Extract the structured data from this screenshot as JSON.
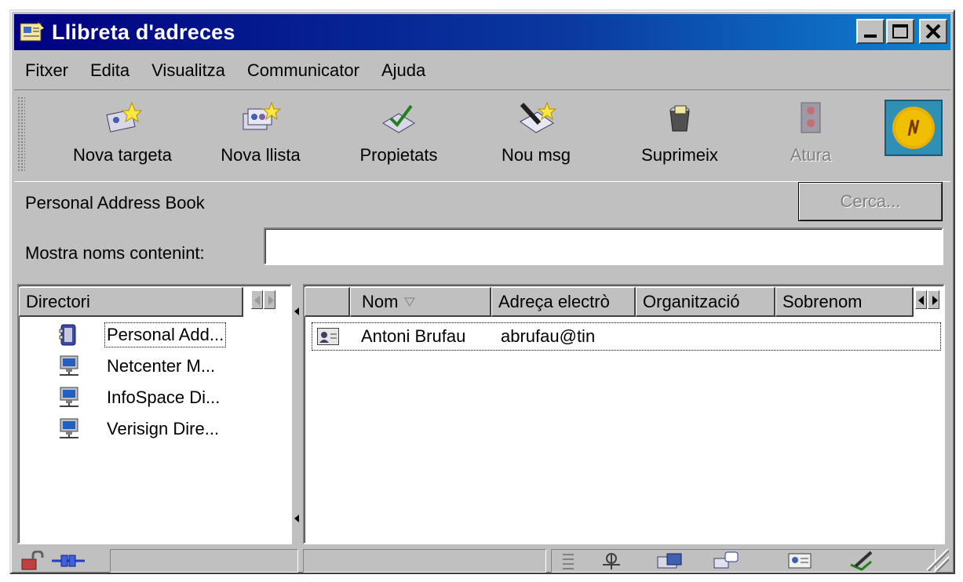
{
  "window": {
    "title": "Llibreta d'adreces"
  },
  "menu": [
    {
      "label": "Fitxer"
    },
    {
      "label": "Edita"
    },
    {
      "label": "Visualitza"
    },
    {
      "label": "Communicator"
    },
    {
      "label": "Ajuda"
    }
  ],
  "toolbar": {
    "new_card": "Nova targeta",
    "new_list": "Nova llista",
    "properties": "Propietats",
    "new_msg": "Nou msg",
    "delete": "Suprimeix",
    "stop": "Atura"
  },
  "book": {
    "name": "Personal Address Book"
  },
  "search": {
    "button": "Cerca...",
    "filter_label": "Mostra noms contenint:",
    "filter_value": ""
  },
  "directory": {
    "header": "Directori",
    "items": [
      {
        "label": "Personal Add...",
        "icon": "address-book-icon"
      },
      {
        "label": "Netcenter M...",
        "icon": "network-computer-icon"
      },
      {
        "label": "InfoSpace Di...",
        "icon": "network-computer-icon"
      },
      {
        "label": "Verisign Dire...",
        "icon": "network-computer-icon"
      }
    ]
  },
  "contacts": {
    "columns": [
      "Nom",
      "Adreça electrò",
      "Organització",
      "Sobrenom"
    ],
    "rows": [
      {
        "name": "Antoni Brufau",
        "email": "abrufau@tin",
        "organization": "",
        "nickname": ""
      }
    ]
  },
  "colors": {
    "titlebar_start": "#000080",
    "titlebar_end": "#1084d0",
    "face": "#c0c0c0"
  }
}
